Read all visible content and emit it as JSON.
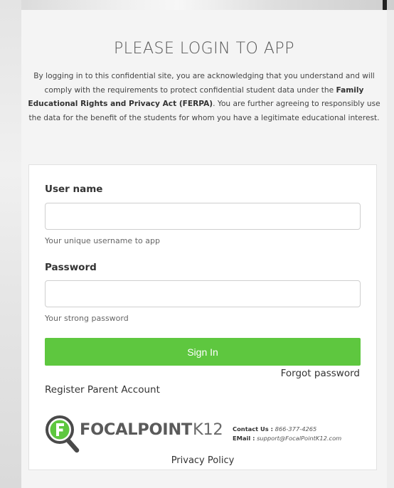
{
  "header": {
    "title": "PLEASE LOGIN TO APP",
    "notice_part1": "By logging in to this confidential site, you are acknowledging that you understand and will comply with the requirements to protect confidential student data under the ",
    "notice_bold": "Family Educational Rights and Privacy Act (FERPA)",
    "notice_part2": ". You are further agreeing to responsibly use the data for the benefit of the students for whom you have a legitimate educational interest."
  },
  "form": {
    "username_label": "User name",
    "username_value": "",
    "username_help": "Your unique username to app",
    "password_label": "Password",
    "password_value": "",
    "password_help": "Your strong password",
    "signin_label": "Sign In",
    "forgot_label": "Forgot password",
    "register_label": "Register Parent Account"
  },
  "footer": {
    "logo_text": "FOCALPOINT",
    "logo_suffix": "K12",
    "contact_label": "Contact Us :",
    "contact_phone": "866-377-4265",
    "email_label": "EMail :",
    "email_value": "support@FocalPointK12.com",
    "privacy_label": "Privacy Policy"
  },
  "colors": {
    "accent_green": "#5ec73f",
    "logo_dark": "#4a4a4a",
    "logo_green": "#5ec73f"
  },
  "icons": {
    "logo_icon": "magnifier-with-letter-f-icon"
  }
}
